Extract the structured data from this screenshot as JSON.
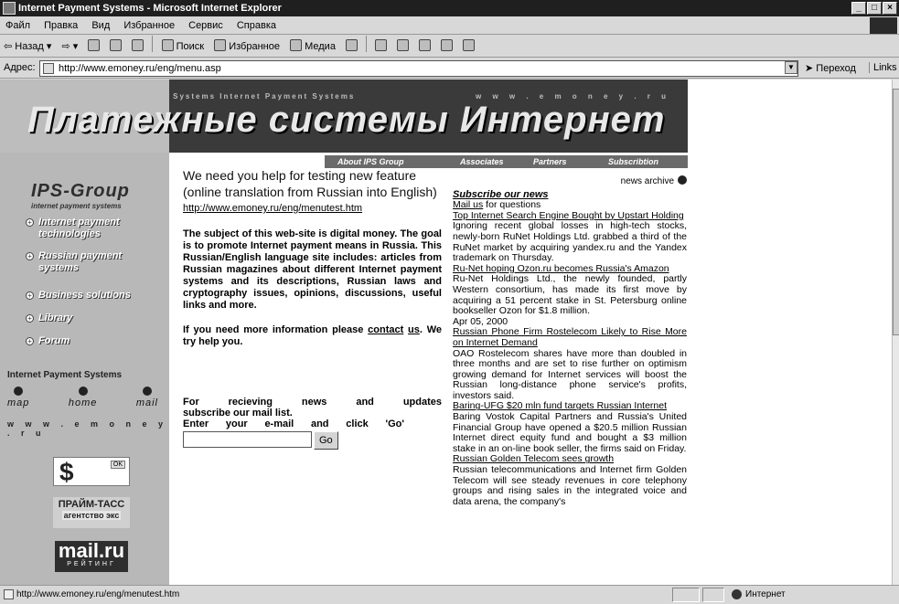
{
  "window": {
    "title": "Internet Payment Systems - Microsoft Internet Explorer",
    "buttons": [
      "_",
      "□",
      "×"
    ]
  },
  "menu": [
    "Файл",
    "Правка",
    "Вид",
    "Избранное",
    "Сервис",
    "Справка"
  ],
  "toolbar": {
    "back": "⇦ Назад ▾",
    "forward": "⇨ ▾",
    "search": "Поиск",
    "favorites": "Избранное",
    "media": "Медиа"
  },
  "address": {
    "label": "Адрес:",
    "url": "http://www.emoney.ru/eng/menu.asp",
    "go_label": "Переход",
    "links_label": "Links"
  },
  "banner": {
    "ticker_left": "Internet Payment Systems Internet Payment Systems",
    "ticker_right": "w w w . e m o n e y . r u",
    "title": "Платежные системы Интернет"
  },
  "left": {
    "logo": "IPS-Group",
    "logo_sub": "internet payment systems",
    "nav": [
      {
        "label": "Internet payment technologies"
      },
      {
        "label": "Russian payment systems"
      },
      {
        "label": "Business solutions"
      },
      {
        "label": "Library"
      },
      {
        "label": "Forum"
      }
    ],
    "section_title": "Internet Payment Systems",
    "quicklinks": [
      "map",
      "home",
      "mail"
    ],
    "site_url": "w w w . e m o n e y . r u",
    "badge_ok": "OK",
    "badge_dollar": "$",
    "badge2_line1": "ПРАЙМ-ТАСС",
    "badge2_line2": "агентство экс",
    "badge3_line1": "mail.ru",
    "badge3_line2": "РЕЙТИНГ"
  },
  "tabs": [
    "About IPS Group",
    "Associates",
    "Partners",
    "Subscribtion"
  ],
  "center": {
    "headline": "We need you help for testing new feature (online translation from Russian into English)",
    "link": "http://www.emoney.ru/eng/menutest.htm",
    "para1": "The subject of this web-site is digital money. The goal is to promote Internet payment means in Russia. This Russian/English language site includes: articles from Russian magazines about different Internet payment systems and its descriptions, Russian laws and cryptography issues, opinions, discussions, useful links and more.",
    "para2_a": "If you need more information please ",
    "para2_link_a": "contact",
    "para2_link_b": "us",
    "para2_b": ". We try help you.",
    "signup_line1": [
      "For",
      "recieving",
      "news",
      "and",
      "updates"
    ],
    "signup_line2": "subscribe our mail list.",
    "signup_line3": [
      "Enter",
      "your",
      "e-mail",
      "and",
      "click",
      "'Go'"
    ],
    "go_button": "Go"
  },
  "news": {
    "archive": "news archive",
    "subscribe": "Subscribe our news",
    "mail_us": "Mail us",
    "mail_us_rest": " for questions",
    "items": [
      {
        "headline": "Top Internet Search Engine Bought by Upstart Holding",
        "body": "Ignoring recent global losses in high-tech stocks, newly-born RuNet Holdings Ltd. grabbed a third of the RuNet market by acquiring yandex.ru and the Yandex trademark on Thursday."
      },
      {
        "headline": "Ru-Net hoping Ozon.ru becomes Russia's Amazon",
        "body": "Ru-Net Holdings Ltd., the newly founded, partly Western consortium, has made its first move by acquiring a 51 percent stake in St. Petersburg online bookseller Ozon for $1.8 million."
      },
      {
        "date": "Apr 05, 2000",
        "headline": "Russian Phone Firm Rostelecom Likely to Rise More on Internet Demand",
        "body": "OAO Rostelecom shares have more than doubled in three months and are set to rise further on optimism growing demand for Internet services will boost the Russian long-distance phone service's profits, investors said."
      },
      {
        "headline": "Baring-UFG $20 mln fund targets Russian Internet",
        "body": "Baring Vostok Capital Partners and Russia's United Financial Group have opened a $20.5 million Russian Internet direct equity fund and bought a $3 million stake in an on-line book seller, the firms said on Friday."
      },
      {
        "headline": "Russian Golden Telecom sees growth",
        "body": "Russian telecommunications and Internet firm Golden Telecom will see steady revenues in core telephony groups and rising sales in the integrated voice and data arena, the company's"
      }
    ]
  },
  "status": {
    "text": "http://www.emoney.ru/eng/menutest.htm",
    "zone": "Интернет"
  }
}
